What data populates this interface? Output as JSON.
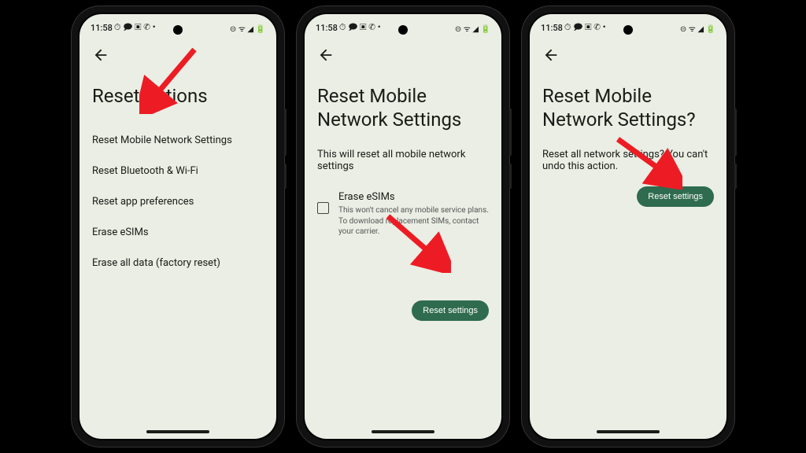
{
  "status": {
    "time": "11:58",
    "left_icons": "⏱ 🗩 ▣ ✆ •",
    "right_icons": "⊝ ᯤ ◢ 🔋"
  },
  "screen1": {
    "title": "Reset options",
    "items": [
      "Reset Mobile Network Settings",
      "Reset Bluetooth & Wi-Fi",
      "Reset app preferences",
      "Erase eSIMs",
      "Erase all data (factory reset)"
    ]
  },
  "screen2": {
    "title": "Reset Mobile Network Settings",
    "description": "This will reset all mobile network settings",
    "option_title": "Erase eSIMs",
    "option_sub": "This won't cancel any mobile service plans. To download replacement SIMs, contact your carrier.",
    "button": "Reset settings"
  },
  "screen3": {
    "title": "Reset Mobile Network Settings?",
    "description": "Reset all network settings? You can't undo this action.",
    "button": "Reset settings"
  }
}
